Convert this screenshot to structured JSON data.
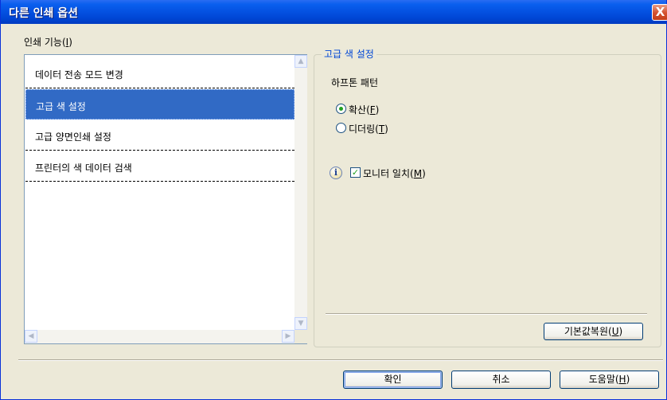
{
  "window": {
    "title": "다른 인쇄 옵션",
    "close_symbol": "X"
  },
  "print_functions": {
    "label": "인쇄 기능(",
    "accel": "I",
    "label_end": ")",
    "items": [
      {
        "label": "데이터 전송 모드 변경"
      },
      {
        "label": "고급 색 설정"
      },
      {
        "label": "고급 양면인쇄 설정"
      },
      {
        "label": "프린터의 색 데이터 검색"
      }
    ],
    "selected_index": 1
  },
  "advanced_color": {
    "group_title": "고급 색 설정",
    "halftone_label": "하프톤 패턴",
    "options": [
      {
        "label": "확산(",
        "accel": "F",
        "end": ")",
        "checked": true
      },
      {
        "label": "디더링(",
        "accel": "T",
        "end": ")",
        "checked": false
      }
    ],
    "monitor_match": {
      "label": "모니터 일치(",
      "accel": "M",
      "end": ")",
      "checked": true
    },
    "info_symbol": "i",
    "reset_button": {
      "label": "기본값복원(",
      "accel": "U",
      "end": ")"
    }
  },
  "footer": {
    "ok": "확인",
    "cancel": "취소",
    "help": {
      "label": "도움말(",
      "accel": "H",
      "end": ")"
    }
  },
  "colors": {
    "title_bar": "#0553e3",
    "selection": "#316ac5",
    "dialog_bg": "#ece9d8",
    "group_title": "#0046d5"
  }
}
